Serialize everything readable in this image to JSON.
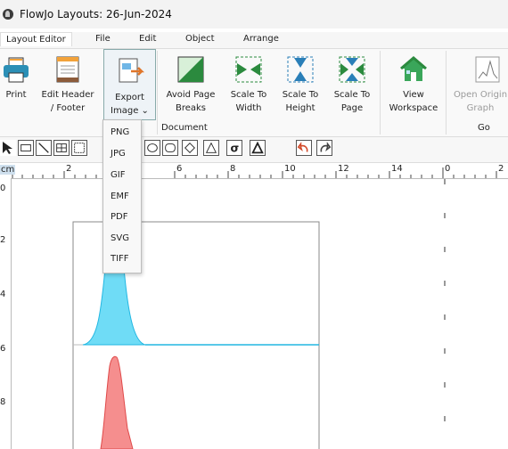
{
  "window": {
    "title": "FlowJo Layouts: 26-Jun-2024"
  },
  "menu": [
    "Layout Editor",
    "File",
    "Edit",
    "Object",
    "Arrange"
  ],
  "ribbon": {
    "print": "Print",
    "edit_header_1": "Edit Header",
    "edit_header_2": "/ Footer",
    "export_1": "Export",
    "export_2": "Image",
    "avoid_1": "Avoid Page",
    "avoid_2": "Breaks",
    "scale_width_1": "Scale To",
    "scale_width_2": "Width",
    "scale_height_1": "Scale To",
    "scale_height_2": "Height",
    "scale_page_1": "Scale To",
    "scale_page_2": "Page",
    "view_ws_1": "View",
    "view_ws_2": "Workspace",
    "open_graph_1": "Open Origin",
    "open_graph_2": "Graph",
    "group_document": "Document",
    "group_go": "Go"
  },
  "dropdown": [
    "PNG",
    "JPG",
    "GIF",
    "EMF",
    "PDF",
    "SVG",
    "TIFF"
  ],
  "ruler": {
    "unit": "cm",
    "top": [
      "2",
      "6",
      "8",
      "10",
      "12",
      "14",
      "0",
      "2"
    ],
    "left": [
      "0",
      "2",
      "4",
      "6",
      "8"
    ]
  },
  "colors": {
    "cyan": "#6fdcf6",
    "red": "#f58e8e"
  }
}
